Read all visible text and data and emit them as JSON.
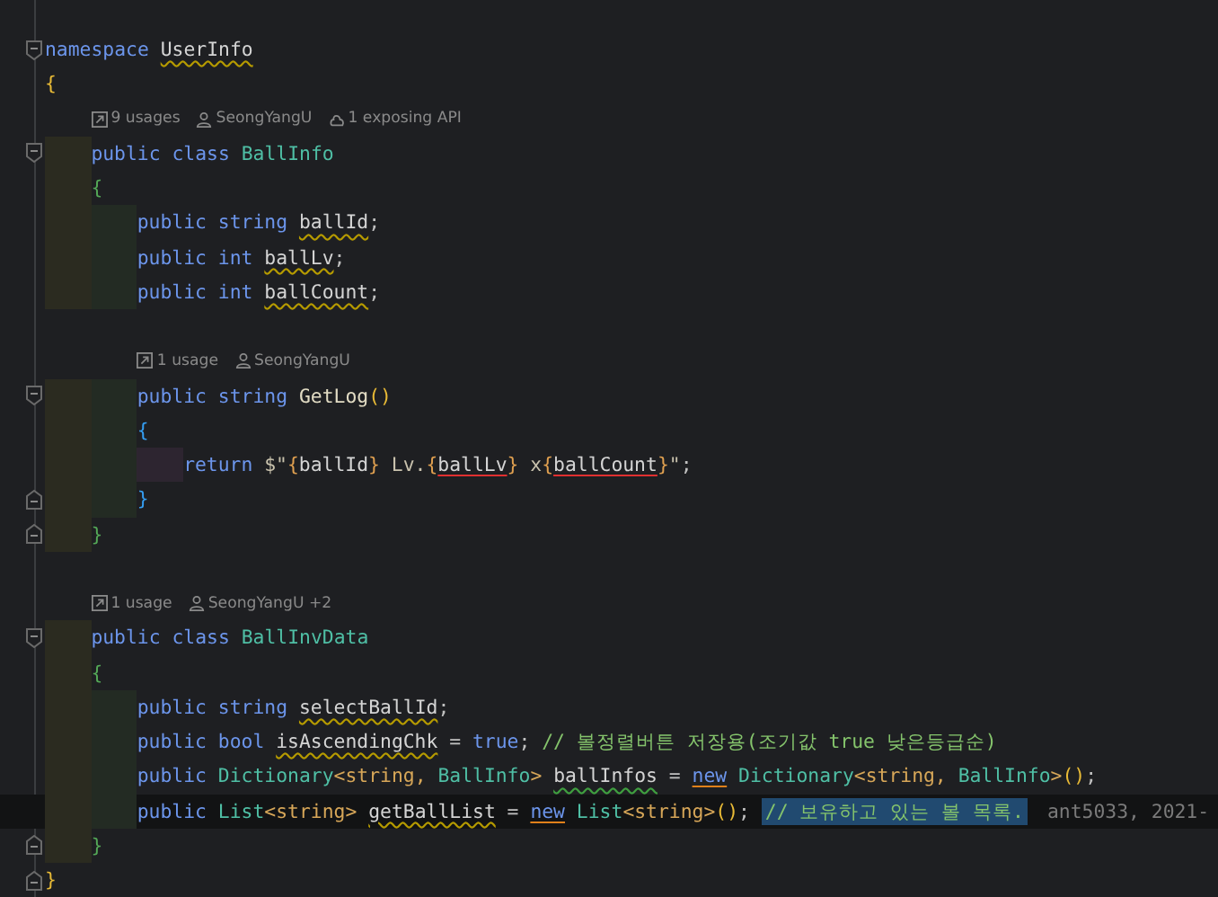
{
  "editor": {
    "lines": [
      {
        "kind": "fold-start",
        "current": false,
        "tokens": [
          {
            "text": "namespace ",
            "kind": "keyword"
          },
          {
            "text": "UserInfo",
            "kind": "warning-ident"
          }
        ]
      },
      {
        "kind": "open",
        "current": false,
        "tokens": [
          {
            "text": "{",
            "kind": "brace1"
          }
        ],
        "children": [
          {
            "kind": "hint",
            "items": [
              {
                "text": "9 usages"
              },
              {
                "text": "SeongYangU"
              },
              {
                "text": "1 exposing API"
              }
            ]
          },
          {
            "kind": "fold-start",
            "current": false,
            "tokens": [
              {
                "text": "public class ",
                "kind": "keyword"
              },
              {
                "text": "BallInfo",
                "kind": "type"
              }
            ]
          },
          {
            "kind": "open",
            "current": false,
            "tokens": [
              {
                "text": "{",
                "kind": "brace2"
              }
            ],
            "children": [
              {
                "kind": "code",
                "current": false,
                "tokens": [
                  {
                    "text": "public string ",
                    "kind": "keyword"
                  },
                  {
                    "text": "ballId",
                    "kind": "warning-ident"
                  },
                  {
                    "text": ";",
                    "kind": "punct"
                  }
                ]
              },
              {
                "kind": "code",
                "current": false,
                "tokens": [
                  {
                    "text": "public int ",
                    "kind": "keyword"
                  },
                  {
                    "text": "ballLv",
                    "kind": "warning-ident"
                  },
                  {
                    "text": ";",
                    "kind": "punct"
                  }
                ]
              },
              {
                "kind": "code",
                "current": false,
                "tokens": [
                  {
                    "text": "public int ",
                    "kind": "keyword"
                  },
                  {
                    "text": "ballCount",
                    "kind": "warning-ident"
                  },
                  {
                    "text": ";",
                    "kind": "punct"
                  }
                ]
              },
              {
                "kind": "blank"
              },
              {
                "kind": "hint",
                "items": [
                  {
                    "text": "1 usage"
                  },
                  {
                    "text": "SeongYangU"
                  }
                ]
              },
              {
                "kind": "fold-start",
                "current": false,
                "tokens": [
                  {
                    "text": "public string ",
                    "kind": "keyword"
                  },
                  {
                    "text": "GetLog",
                    "kind": "method"
                  },
                  {
                    "text": "()",
                    "kind": "brace1"
                  }
                ]
              },
              {
                "kind": "open",
                "current": false,
                "tokens": [
                  {
                    "text": "{",
                    "kind": "brace3"
                  }
                ],
                "children": [
                  {
                    "kind": "code",
                    "current": false,
                    "tokens": [
                      {
                        "text": "return ",
                        "kind": "keyword"
                      },
                      {
                        "text": "$\"",
                        "kind": "string"
                      },
                      {
                        "text": "{",
                        "kind": "interp"
                      },
                      {
                        "text": "ballId",
                        "kind": "ident"
                      },
                      {
                        "text": "}",
                        "kind": "interp"
                      },
                      {
                        "text": " Lv.",
                        "kind": "string"
                      },
                      {
                        "text": "{",
                        "kind": "interp"
                      },
                      {
                        "text": "ballLv",
                        "kind": "error-ident"
                      },
                      {
                        "text": "}",
                        "kind": "interp"
                      },
                      {
                        "text": " x",
                        "kind": "string"
                      },
                      {
                        "text": "{",
                        "kind": "interp"
                      },
                      {
                        "text": "ballCount",
                        "kind": "error-ident"
                      },
                      {
                        "text": "}",
                        "kind": "interp"
                      },
                      {
                        "text": "\"",
                        "kind": "string"
                      },
                      {
                        "text": ";",
                        "kind": "punct"
                      }
                    ]
                  }
                ]
              },
              {
                "kind": "fold-end",
                "current": false,
                "tokens": [
                  {
                    "text": "}",
                    "kind": "brace3"
                  }
                ]
              }
            ]
          },
          {
            "kind": "fold-end",
            "current": false,
            "tokens": [
              {
                "text": "}",
                "kind": "brace2"
              }
            ]
          },
          {
            "kind": "blank"
          },
          {
            "kind": "hint",
            "items": [
              {
                "text": "1 usage"
              },
              {
                "text": "SeongYangU +2"
              }
            ]
          },
          {
            "kind": "fold-start",
            "current": false,
            "tokens": [
              {
                "text": "public class ",
                "kind": "keyword"
              },
              {
                "text": "BallInvData",
                "kind": "type"
              }
            ]
          },
          {
            "kind": "open",
            "current": false,
            "tokens": [
              {
                "text": "{",
                "kind": "brace2"
              }
            ],
            "children": [
              {
                "kind": "code",
                "current": false,
                "tokens": [
                  {
                    "text": "public string ",
                    "kind": "keyword"
                  },
                  {
                    "text": "selectBallId",
                    "kind": "warning-ident"
                  },
                  {
                    "text": ";",
                    "kind": "punct"
                  }
                ]
              },
              {
                "kind": "code",
                "current": false,
                "tokens": [
                  {
                    "text": "public bool ",
                    "kind": "keyword"
                  },
                  {
                    "text": "isAscendingChk",
                    "kind": "warning-ident"
                  },
                  {
                    "text": " = ",
                    "kind": "punct"
                  },
                  {
                    "text": "true",
                    "kind": "keyword"
                  },
                  {
                    "text": "; ",
                    "kind": "punct"
                  },
                  {
                    "text": "// 볼정렬버튼 저장용(조기값 true 낮은등급순)",
                    "kind": "comment"
                  }
                ]
              },
              {
                "kind": "code",
                "current": false,
                "tokens": [
                  {
                    "text": "public ",
                    "kind": "keyword"
                  },
                  {
                    "text": "Dictionary",
                    "kind": "type"
                  },
                  {
                    "text": "<string, ",
                    "kind": "generic"
                  },
                  {
                    "text": "BallInfo",
                    "kind": "type"
                  },
                  {
                    "text": "> ",
                    "kind": "generic"
                  },
                  {
                    "text": "ballInfos",
                    "kind": "suggestion-ident"
                  },
                  {
                    "text": " = ",
                    "kind": "punct"
                  },
                  {
                    "text": "new",
                    "kind": "usage-keyword"
                  },
                  {
                    "text": " Dictionary",
                    "kind": "type"
                  },
                  {
                    "text": "<string, ",
                    "kind": "generic"
                  },
                  {
                    "text": "BallInfo",
                    "kind": "type"
                  },
                  {
                    "text": ">",
                    "kind": "generic"
                  },
                  {
                    "text": "()",
                    "kind": "brace1"
                  },
                  {
                    "text": ";",
                    "kind": "punct"
                  }
                ]
              },
              {
                "kind": "code",
                "current": true,
                "tokens": [
                  {
                    "text": "public ",
                    "kind": "keyword"
                  },
                  {
                    "text": "List",
                    "kind": "type"
                  },
                  {
                    "text": "<string> ",
                    "kind": "generic"
                  },
                  {
                    "text": "getBallList",
                    "kind": "warning-ident"
                  },
                  {
                    "text": " = ",
                    "kind": "punct"
                  },
                  {
                    "text": "new",
                    "kind": "usage-keyword"
                  },
                  {
                    "text": " List",
                    "kind": "type"
                  },
                  {
                    "text": "<string>",
                    "kind": "generic"
                  },
                  {
                    "text": "()",
                    "kind": "brace1"
                  },
                  {
                    "text": "; ",
                    "kind": "punct"
                  }
                ],
                "selection": "// 보유하고 있는 볼 목록.",
                "blame": "ant5033, 2021-"
              }
            ]
          },
          {
            "kind": "fold-end",
            "current": false,
            "tokens": [
              {
                "text": "}",
                "kind": "brace2"
              }
            ]
          }
        ]
      },
      {
        "kind": "fold-end",
        "current": false,
        "tokens": [
          {
            "text": "}",
            "kind": "brace1"
          }
        ]
      }
    ]
  }
}
